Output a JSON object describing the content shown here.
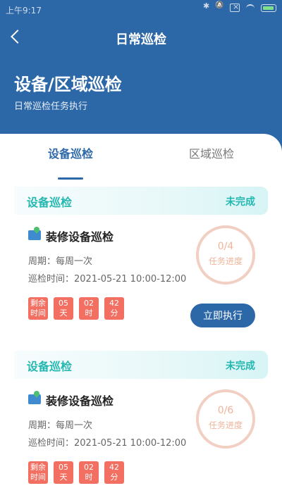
{
  "status_bar": {
    "time": "上午9:17"
  },
  "nav": {
    "title": "日常巡检"
  },
  "hero": {
    "title": "设备/区域巡检",
    "subtitle": "日常巡检任务执行"
  },
  "tabs": [
    {
      "label": "设备巡检",
      "active": true
    },
    {
      "label": "区域巡检",
      "active": false
    }
  ],
  "cards": [
    {
      "header_title": "设备巡检",
      "status": "未完成",
      "task_title": "装修设备巡检",
      "period": "周期：每周一次",
      "time": "巡检时间：2021-05-21 10:00-12:00",
      "timer": [
        {
          "line1": "剩余",
          "line2": "时间"
        },
        {
          "line1": "05",
          "line2": "天"
        },
        {
          "line1": "02",
          "line2": "时"
        },
        {
          "line1": "42",
          "line2": "分"
        }
      ],
      "progress_count": "0/4",
      "progress_label": "任务进度",
      "button_label": "立即执行"
    },
    {
      "header_title": "设备巡检",
      "status": "未完成",
      "task_title": "装修设备巡检",
      "period": "周期：每周一次",
      "time": "巡检时间：2021-05-21 10:00-12:00",
      "timer": [
        {
          "line1": "剩余",
          "line2": "时间"
        },
        {
          "line1": "05",
          "line2": "天"
        },
        {
          "line1": "02",
          "line2": "时"
        },
        {
          "line1": "42",
          "line2": "分"
        }
      ],
      "progress_count": "0/6",
      "progress_label": "任务进度"
    }
  ],
  "colors": {
    "primary": "#2c67a8",
    "accent": "#23b7b0",
    "timer": "#f26f61",
    "progress": "#f0b49b"
  }
}
